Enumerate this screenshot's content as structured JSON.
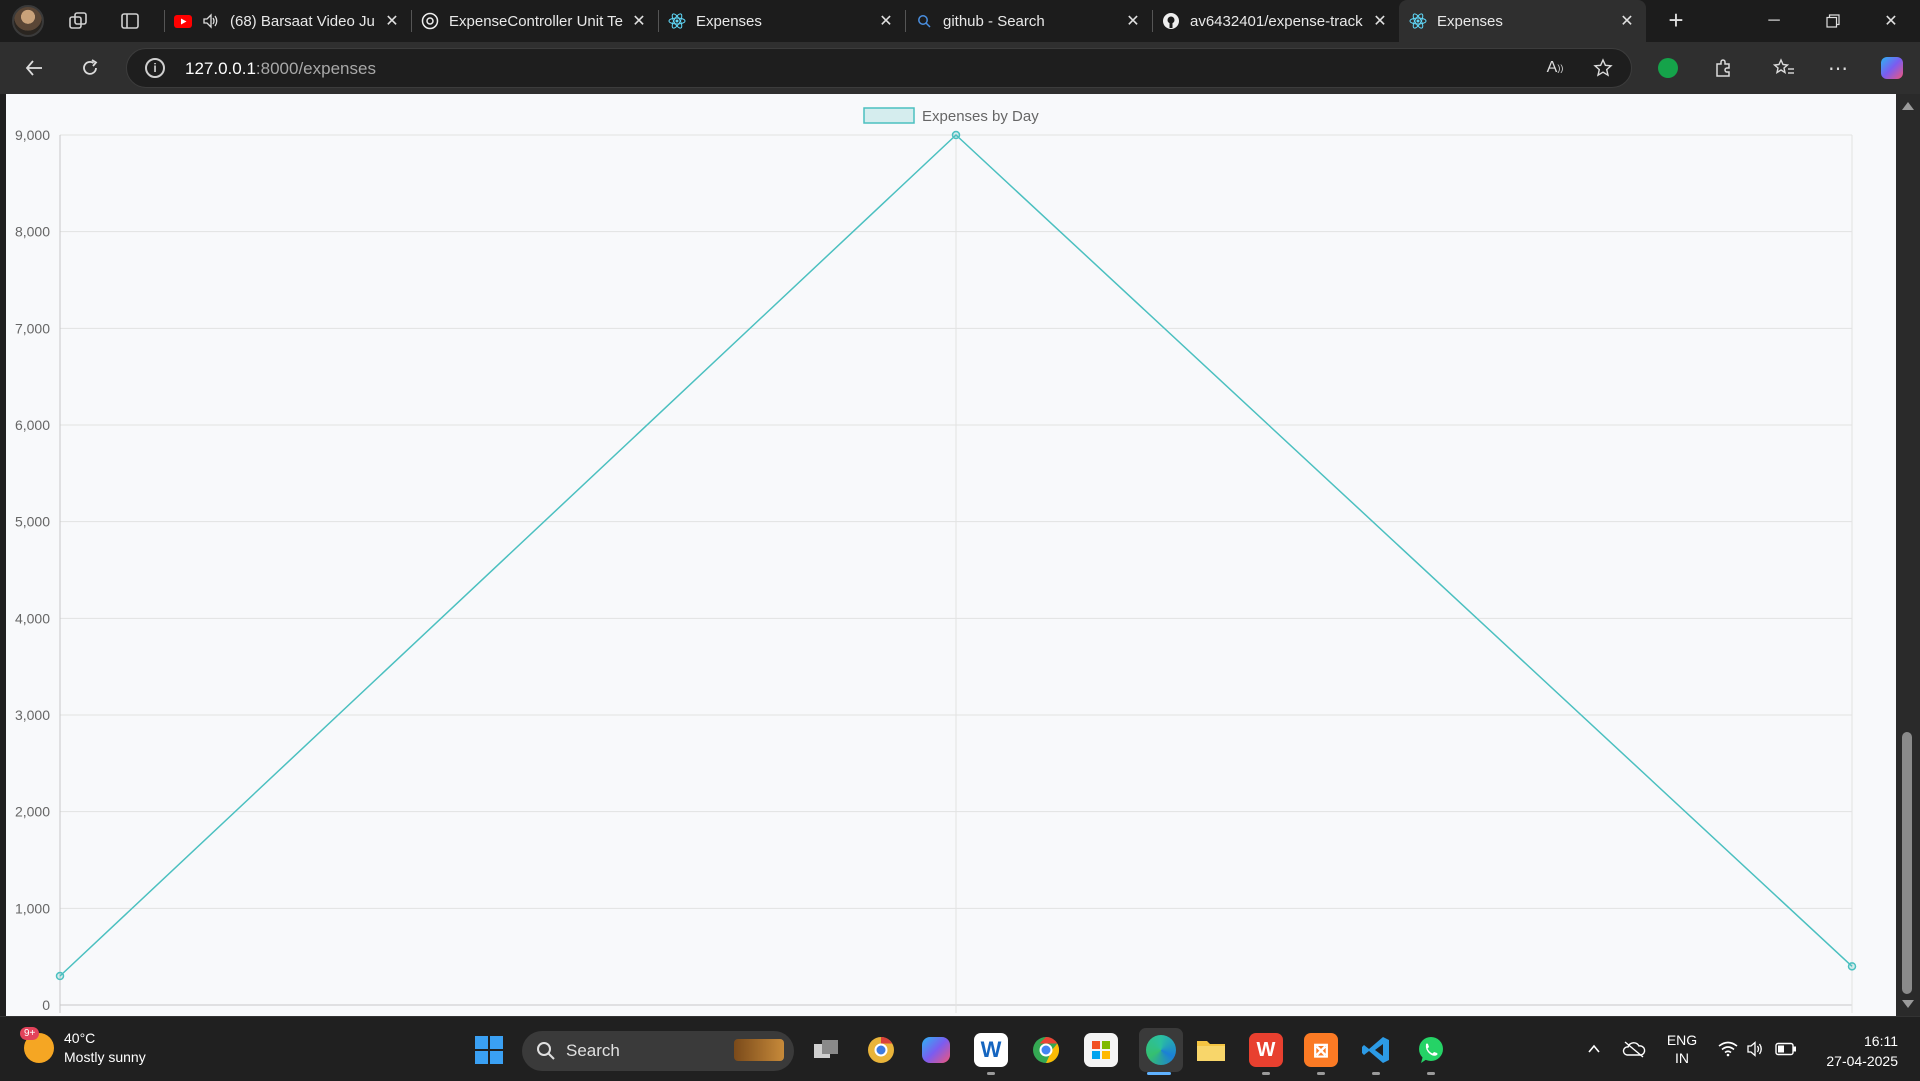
{
  "browser": {
    "tabs": [
      {
        "title": "(68) Barsaat Video Ju",
        "favicon": "youtube-icon",
        "audio": true
      },
      {
        "title": "ExpenseController Unit Te",
        "favicon": "openai-icon"
      },
      {
        "title": "Expenses",
        "favicon": "react-icon"
      },
      {
        "title": "github - Search",
        "favicon": "search-icon"
      },
      {
        "title": "av6432401/expense-track",
        "favicon": "github-icon"
      },
      {
        "title": "Expenses",
        "favicon": "react-icon",
        "active": true
      }
    ],
    "address": {
      "host": "127.0.0.1",
      "path": ":8000/expenses"
    }
  },
  "chart_data": {
    "type": "line",
    "legend": {
      "label": "Expenses by Day",
      "position": "top-center"
    },
    "x_points": 3,
    "series": [
      {
        "name": "Expenses by Day",
        "values": [
          300,
          9000,
          400
        ],
        "color": "#4bc0c0"
      }
    ],
    "ylim": [
      0,
      9000
    ],
    "yticks": [
      "0",
      "1,000",
      "2,000",
      "3,000",
      "4,000",
      "5,000",
      "6,000",
      "7,000",
      "8,000",
      "9,000"
    ],
    "grid": true
  },
  "taskbar": {
    "weather": {
      "temp": "40°C",
      "desc": "Mostly sunny",
      "badge": "9+"
    },
    "search_label": "Search",
    "lang": "ENG",
    "region": "IN",
    "time": "16:11",
    "date": "27-04-2025"
  }
}
